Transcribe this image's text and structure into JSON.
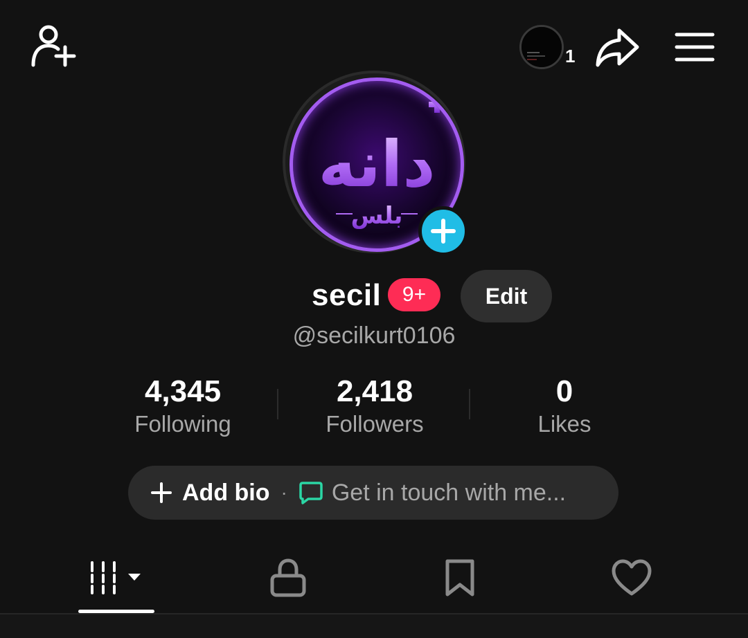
{
  "header": {
    "add_friend_icon": "person-add-icon",
    "story_count": "1",
    "share_icon": "share-arrow-icon",
    "menu_icon": "hamburger-menu-icon"
  },
  "profile": {
    "avatar_icon": "profile-avatar",
    "add_avatar_icon": "plus-icon",
    "avatar_logo_text": "دانه",
    "avatar_logo_subtext": "بلس",
    "display_name": "secil",
    "notification_badge": "9+",
    "edit_label": "Edit",
    "handle": "@secilkurt0106"
  },
  "stats": {
    "following": {
      "value": "4,345",
      "label": "Following"
    },
    "followers": {
      "value": "2,418",
      "label": "Followers"
    },
    "likes": {
      "value": "0",
      "label": "Likes"
    }
  },
  "bio": {
    "add_label": "Add bio",
    "separator": "·",
    "contact_label": "Get in touch with me..."
  },
  "tabs": {
    "items": [
      {
        "name": "videos",
        "icon": "grid-columns-icon"
      },
      {
        "name": "private",
        "icon": "lock-icon"
      },
      {
        "name": "saved",
        "icon": "bookmark-icon"
      },
      {
        "name": "liked",
        "icon": "heart-icon"
      }
    ],
    "active": "videos"
  },
  "colors": {
    "background": "#121212",
    "badge": "#fe2c55",
    "add_button": "#20bde6",
    "chat_icon": "#2bd6a5",
    "avatar_ring": "#a35cf0"
  }
}
